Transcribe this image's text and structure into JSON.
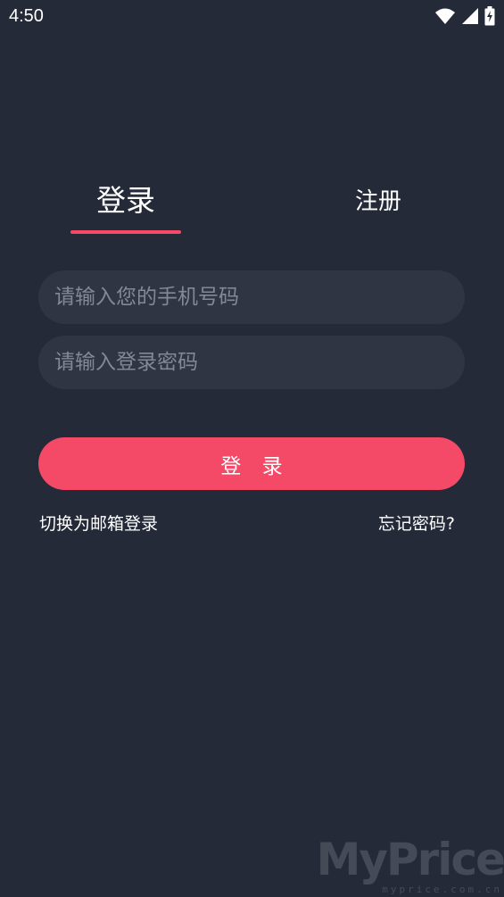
{
  "status_bar": {
    "time": "4:50"
  },
  "tabs": {
    "login": "登录",
    "register": "注册",
    "active": "login"
  },
  "form": {
    "phone_placeholder": "请输入您的手机号码",
    "password_placeholder": "请输入登录密码",
    "phone_value": "",
    "password_value": ""
  },
  "login_button": "登 录",
  "links": {
    "switch_email": "切换为邮箱登录",
    "forgot_password": "忘记密码?"
  },
  "watermark": {
    "logo": "MyPrice",
    "url": "myprice.com.cn"
  },
  "colors": {
    "background": "#252a38",
    "input_bg": "#2f3543",
    "accent": "#f44a68"
  }
}
